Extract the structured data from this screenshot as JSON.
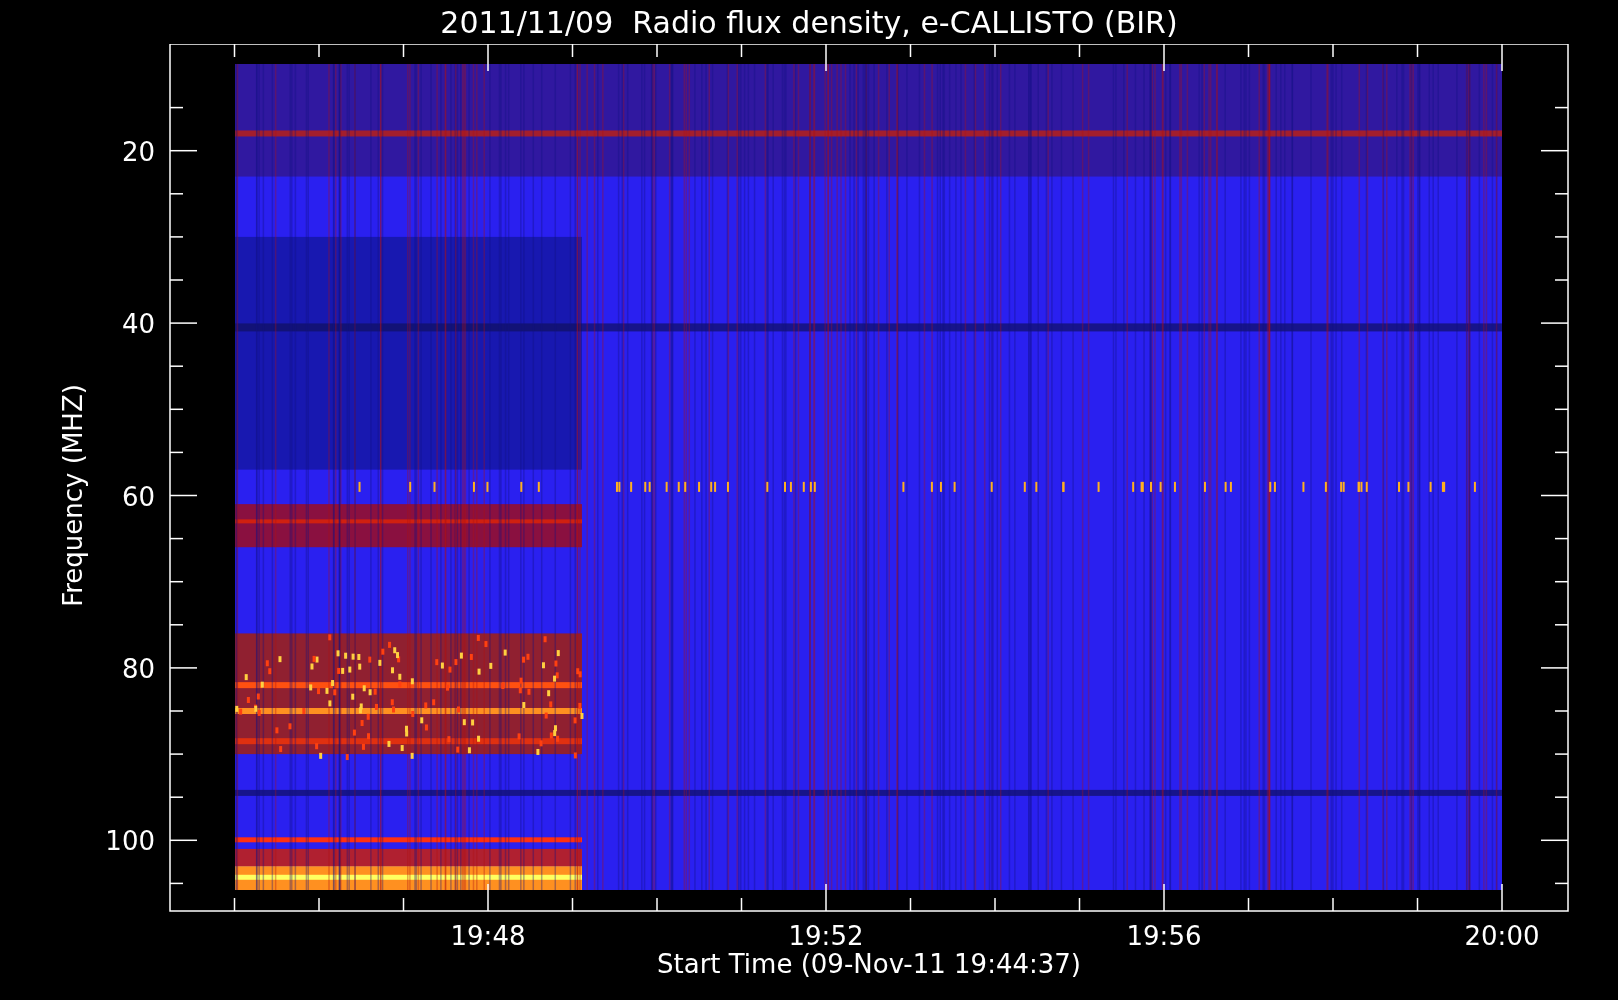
{
  "title": "2011/11/09  Radio flux density, e-CALLISTO (BIR)",
  "y_axis": {
    "label": "Frequency (MHZ)",
    "ticks": [
      "20",
      "40",
      "60",
      "80",
      "100"
    ]
  },
  "x_axis": {
    "label": "Start Time (09-Nov-11 19:44:37)",
    "ticks": [
      "19:48",
      "19:52",
      "19:56",
      "20:00"
    ]
  }
}
